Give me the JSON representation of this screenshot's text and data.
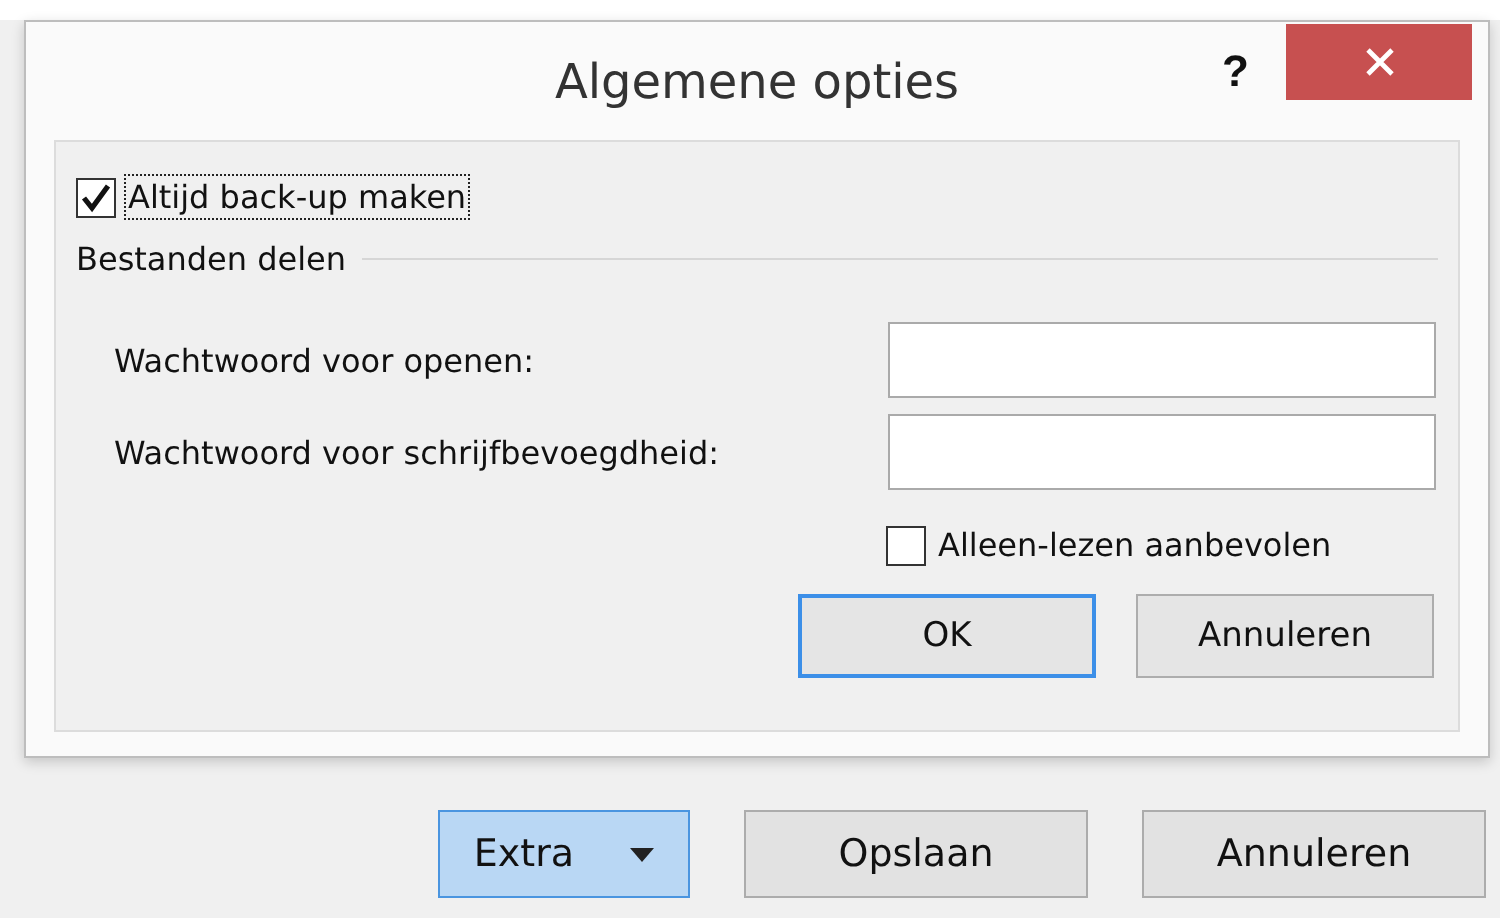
{
  "dialog": {
    "title": "Algemene opties",
    "help": "?"
  },
  "backup": {
    "label": "Altijd back-up maken",
    "checked": true,
    "focused": true
  },
  "group": {
    "label": "Bestanden delen"
  },
  "fields": [
    {
      "label": "Wachtwoord voor openen:"
    },
    {
      "label": "Wachtwoord voor schrijfbevoegdheid:"
    }
  ],
  "readonly": {
    "label": "Alleen-lezen aanbevolen",
    "checked": false
  },
  "buttons": [
    {
      "label": "OK",
      "default": true
    },
    {
      "label": "Annuleren",
      "default": false
    }
  ],
  "footer_buttons": [
    {
      "label": "Extra",
      "kind": "split",
      "highlighted": true
    },
    {
      "label": "Opslaan",
      "kind": "plain",
      "highlighted": false
    },
    {
      "label": "Annuleren",
      "kind": "plain",
      "highlighted": false
    }
  ]
}
